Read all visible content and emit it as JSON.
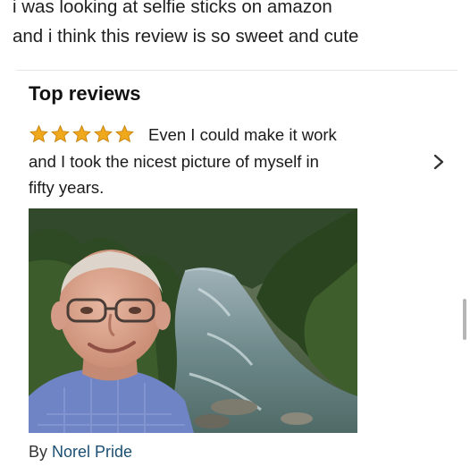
{
  "caption": {
    "line1": "i was looking at selfie sticks on amazon",
    "line2": "and i think this review is so sweet and cute"
  },
  "reviews": {
    "title": "Top reviews",
    "rating": 5,
    "rating_max": 5,
    "star_color": "#f0a81c",
    "review": {
      "line1": "Even I could make it work",
      "line2": "and I took the nicest picture of myself in",
      "line3": "fifty years."
    },
    "author_prefix": "By",
    "author_name": "Norel Pride"
  },
  "icons": {
    "next": "chevron-right-icon",
    "star": "star-icon"
  }
}
